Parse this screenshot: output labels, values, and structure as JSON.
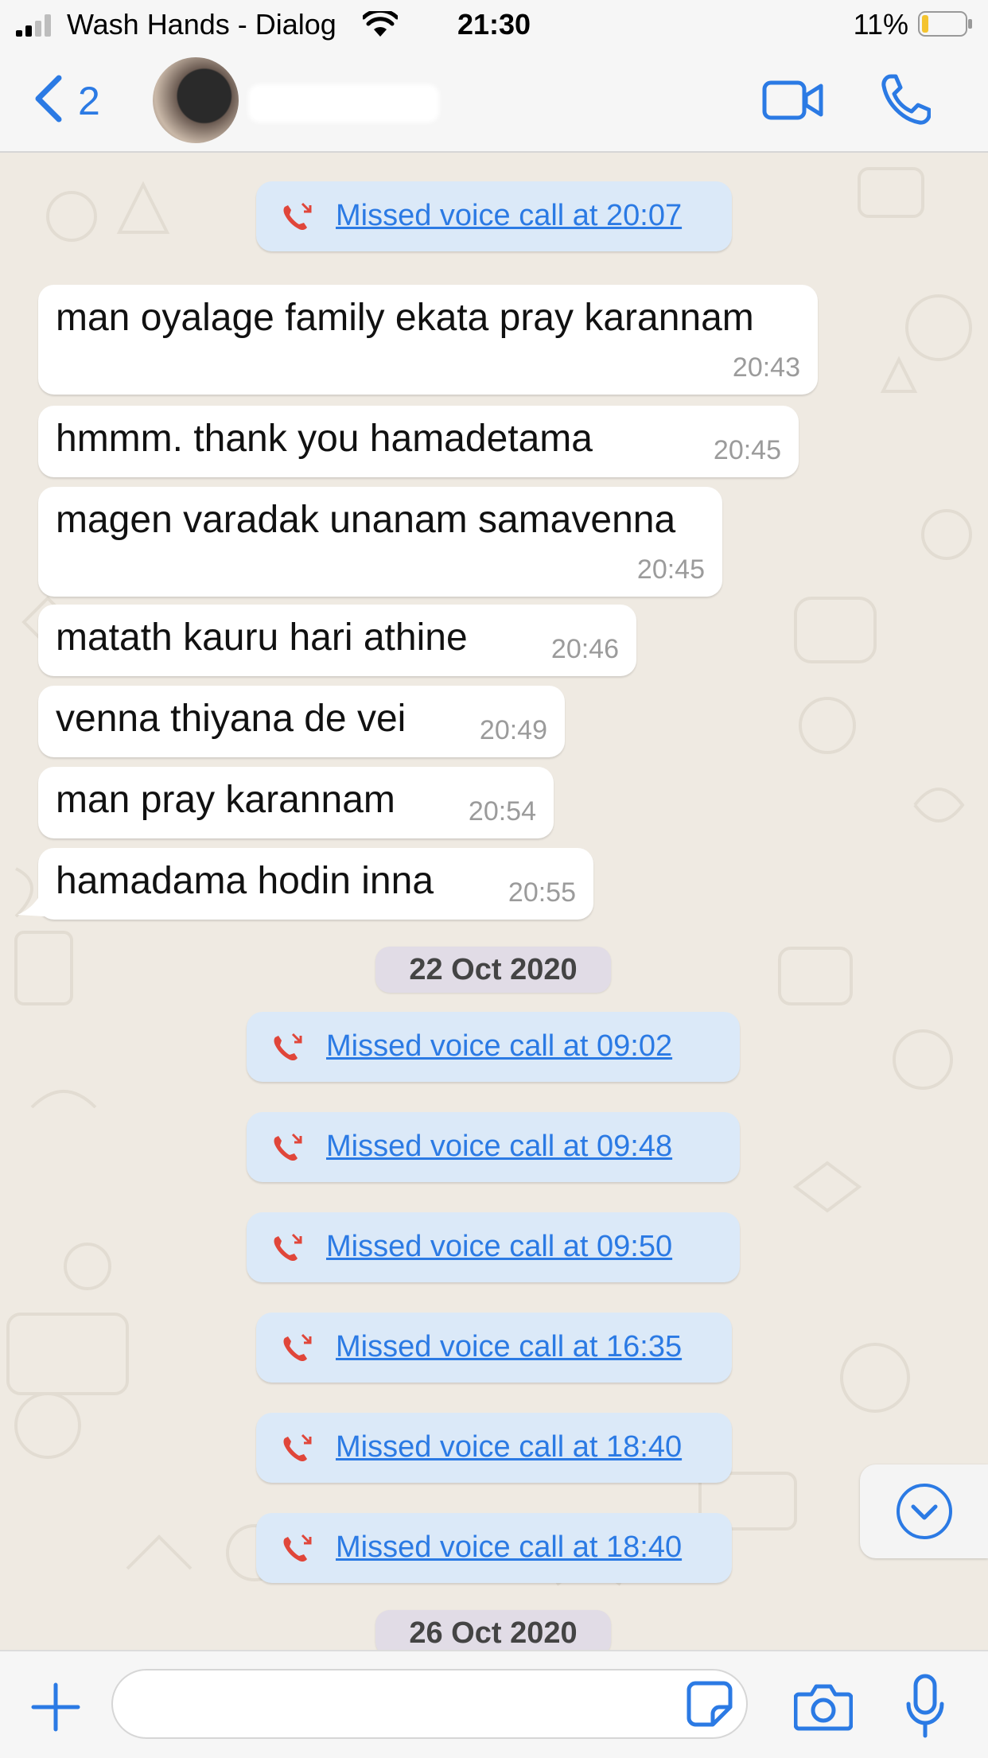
{
  "status": {
    "carrier": "Wash Hands - Dialog",
    "time": "21:30",
    "battery_pct": "11%"
  },
  "header": {
    "back_count": "2",
    "contact_name": ""
  },
  "missed_call_prefix_icon": "missed-call-icon",
  "messages": [
    {
      "text": "man oyalage family ekata pray karannam",
      "time": "20:43"
    },
    {
      "text": "hmmm. thank you hamadetama",
      "time": "20:45"
    },
    {
      "text": "magen varadak unanam samavenna",
      "time": "20:45"
    },
    {
      "text": "matath kauru hari athine",
      "time": "20:46"
    },
    {
      "text": "venna thiyana de vei",
      "time": "20:49"
    },
    {
      "text": "man pray karannam",
      "time": "20:54"
    },
    {
      "text": "hamadama hodin inna",
      "time": "20:55"
    }
  ],
  "missed_calls": [
    "Missed voice call at 20:07",
    "Missed voice call at 09:02",
    "Missed voice call at 09:48",
    "Missed voice call at 09:50",
    "Missed voice call at 16:35",
    "Missed voice call at 18:40",
    "Missed voice call at 18:40"
  ],
  "dates": [
    "22 Oct 2020",
    "26 Oct 2020"
  ],
  "colors": {
    "accent": "#2b7ae4",
    "missed_call_red": "#e0463a",
    "system_bubble": "#dbe9f8",
    "date_pill": "#e1dce6",
    "chat_bg": "#efeae2"
  }
}
